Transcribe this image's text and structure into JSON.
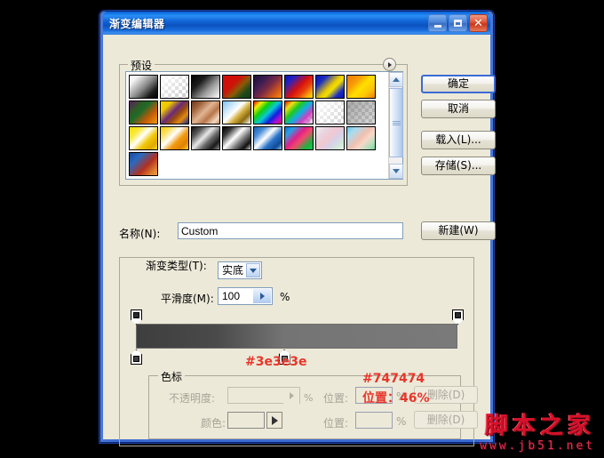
{
  "window": {
    "title": "渐变编辑器",
    "buttons": {
      "minimize": "_",
      "maximize": "□",
      "close": "✕"
    }
  },
  "preset": {
    "group_label": "预设",
    "arrow_icon": "play-arrow-icon",
    "swatches": [
      {
        "name": "Foreground to Background",
        "css": "linear-gradient(135deg,#ffffff 0%,#f2f2f2 18%,#8a8a8a 52%,#1a1a1a 80%,#000000 100%)",
        "checker": false
      },
      {
        "name": "Foreground to Transparent",
        "css": "linear-gradient(135deg,#ffffff 0%,rgba(255,255,255,0) 100%)",
        "checker": true
      },
      {
        "name": "Black White",
        "css": "linear-gradient(135deg,#000000 0%,#1c1c1c 30%,#9a9a9a 62%,#ffffff 100%)",
        "checker": false
      },
      {
        "name": "Red Green",
        "css": "linear-gradient(135deg,#d40b0b 0%,#cf1208 38%,#8a5a06 58%,#20491a 78%,#123d14 100%)",
        "checker": false
      },
      {
        "name": "Violet Orange",
        "css": "linear-gradient(135deg,#1a1030 0%,#3c1d52 28%,#7a2a45 52%,#d4591a 78%,#f58f12 100%)",
        "checker": false
      },
      {
        "name": "Blue Red Yellow",
        "css": "linear-gradient(135deg,#0a12b4 0%,#2422c4 20%,#d41010 50%,#e8400c 68%,#f6b40a 88%,#fbe000 100%)",
        "checker": false
      },
      {
        "name": "Blue Yellow Blue",
        "css": "linear-gradient(135deg,#0a12b4 0%,#1b2ec0 22%,#e8c808 50%,#f2e000 60%,#1b2ec0 82%,#0a12b4 100%)",
        "checker": false
      },
      {
        "name": "Orange Yellow Orange",
        "css": "linear-gradient(135deg,#f07a08 0%,#f79a08 28%,#ffe000 52%,#fbc408 76%,#f07a08 100%)",
        "checker": false
      },
      {
        "name": "Violet Green Orange",
        "css": "linear-gradient(135deg,#5a1c66 0%,#2e5e22 28%,#1d6b2a 42%,#c05a08 70%,#f79a0a 100%)",
        "checker": false
      },
      {
        "name": "Yellow Violet Orange Blue",
        "css": "linear-gradient(135deg,#f2d000 0%,#f0c800 22%,#6a2a7a 46%,#9a4a10 62%,#e08a10 78%,#1a2a9a 100%)",
        "checker": false
      },
      {
        "name": "Copper",
        "css": "linear-gradient(135deg,#6b3a1e 0%,#a0643c 22%,#e0b594 46%,#b8764a 66%,#f0d8c4 86%,#c98a5c 100%)",
        "checker": false
      },
      {
        "name": "Chrome",
        "css": "linear-gradient(135deg,#7fc4f2 0%,#bfe2f8 22%,#ffffff 44%,#d4b042 60%,#8a6a10 78%,#ffffff 100%)",
        "checker": false
      },
      {
        "name": "Spectrum",
        "css": "linear-gradient(135deg,#e80a0a 0%,#f0f000 16%,#10d010 34%,#08c8d8 52%,#1020e0 70%,#b010d0 86%,#e80a4a 100%)",
        "checker": false
      },
      {
        "name": "Transparent Rainbow",
        "css": "linear-gradient(135deg,#e01010 0%,#f0e010 18%,#20c820 36%,#10b0e0 54%,#d040c0 74%,rgba(255,255,255,0) 100%)",
        "checker": true
      },
      {
        "name": "Transparent Stripes",
        "css": "linear-gradient(135deg,rgba(255,255,255,0.95) 0%,rgba(255,255,255,0.2) 100%)",
        "checker": true
      },
      {
        "name": "Transparent to Gray",
        "css": "linear-gradient(135deg,rgba(140,140,140,0.75) 0%,rgba(160,160,160,0.4) 100%)",
        "checker": true
      },
      {
        "name": "Yellow Gold",
        "css": "linear-gradient(135deg,#f6e000 0%,#fbe840 24%,#ffffff 44%,#f0c808 64%,#e0a800 84%,#f8e020 100%)",
        "checker": false
      },
      {
        "name": "Orange Gold",
        "css": "linear-gradient(135deg,#fbd000 0%,#fde268 22%,#ffffff 42%,#f09a10 62%,#e08000 82%,#fbd020 100%)",
        "checker": false
      },
      {
        "name": "Steel Bar",
        "css": "linear-gradient(135deg,#101010 0%,#5a5a5a 22%,#e8e8e8 44%,#6a6a6a 62%,#1a1a1a 82%,#8a8a8a 100%)",
        "checker": false
      },
      {
        "name": "Silver Bar",
        "css": "linear-gradient(135deg,#000000 0%,#3a3a3a 20%,#ffffff 44%,#7a7a7a 64%,#101010 84%,#c8c8c8 100%)",
        "checker": false
      },
      {
        "name": "Blue Glass",
        "css": "linear-gradient(135deg,#1c5fb0 0%,#4a8fd8 22%,#ffffff 44%,#2a74c8 64%,#124a96 84%,#8ab8e8 100%)",
        "checker": false
      },
      {
        "name": "Rainbow Bar",
        "css": "linear-gradient(135deg,#1070d8 0%,#28a0e8 18%,#e0208a 42%,#f04a6a 58%,#20b040 82%,#10c850 100%)",
        "checker": false
      },
      {
        "name": "Pastel Rainbow",
        "css": "linear-gradient(135deg,#f0f0f0 0%,#e8d4e0 26%,#f0c8d0 46%,#d8d0e8 64%,#d0e8d8 84%,#e8f0e8 100%)",
        "checker": false
      },
      {
        "name": "Sky Pastel",
        "css": "linear-gradient(135deg,#6ec4e8 0%,#a8dcf0 20%,#f0c0b0 48%,#f8d8c8 64%,#a8e0b8 86%,#78d098 100%)",
        "checker": false
      },
      {
        "name": "Blue Red",
        "css": "linear-gradient(135deg,#1a4a9a 0%,#2a6ac0 26%,#b03020 60%,#e08030 85%,#f0a040 100%)",
        "checker": false
      }
    ]
  },
  "name_row": {
    "label": "名称(N):",
    "value": "Custom"
  },
  "side_buttons": {
    "ok": "确定",
    "cancel": "取消",
    "load": "载入(L)...",
    "save": "存储(S)...",
    "new": "新建(W)"
  },
  "gradient_type": {
    "group_label": "渐变类型(T):",
    "type_label": "渐变类型(T):",
    "type_value": "实底",
    "smoothness_label": "平滑度(M):",
    "smoothness_value": "100",
    "percent": "%"
  },
  "gradient_bar": {
    "css": "linear-gradient(to right,#3e3e3e 0%,#4a4a4a 25%,#747474 46%,#767676 62%,#7a7a7a 100%)",
    "stops_top": [
      {
        "name": "opacity-stop-left",
        "pos_pct": 0,
        "color": "#2b2b2b"
      },
      {
        "name": "opacity-stop-right",
        "pos_pct": 100,
        "color": "#2b2b2b"
      }
    ],
    "stops_bottom": [
      {
        "name": "color-stop-left",
        "pos_pct": 0,
        "color": "#3e3e3e"
      },
      {
        "name": "color-stop-mid",
        "pos_pct": 46,
        "color": "#747474"
      }
    ]
  },
  "annotations": {
    "left_hex": "#3e3e3e",
    "mid_hex": "#747474",
    "position": "位置：46%"
  },
  "color_stop_group": {
    "group_label": "色标",
    "opacity_label": "不透明度:",
    "opacity_value": "",
    "opacity_pct": "%",
    "opacity_pos_label": "位置:",
    "opacity_pos_value": "",
    "opacity_pos_pct": "%",
    "opacity_delete": "删除(D)",
    "color_label": "颜色:",
    "color_value": "",
    "color_pos_label": "位置:",
    "color_pos_value": "",
    "color_pos_pct": "%",
    "color_delete": "删除(D)"
  },
  "watermark": {
    "main": "脚本之家",
    "url": "www.jb51.net"
  }
}
